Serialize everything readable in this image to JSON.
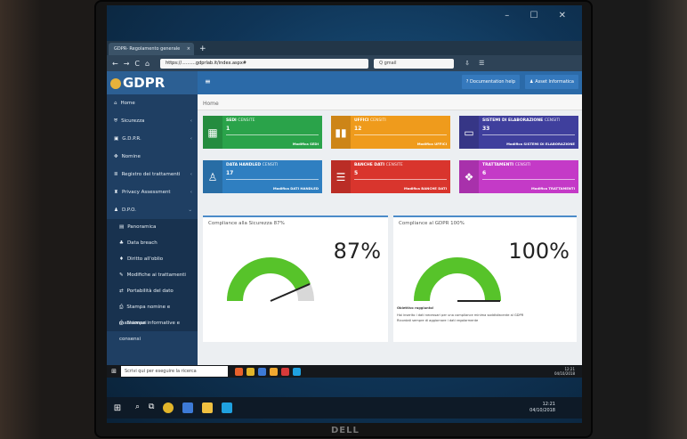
{
  "browser": {
    "tab_title": "GDPR- Regolamento generale",
    "tab_close": "×",
    "new_tab": "+",
    "url": "https://..........gdprlab.it/index.aspx#",
    "search_value": "Q gmail",
    "nav_back": "←",
    "nav_forward": "→",
    "nav_reload": "C",
    "nav_home": "⌂"
  },
  "app": {
    "brand": "GDPR",
    "topbar": {
      "menu_icon": "≡",
      "doc_help": "Documentation help",
      "user": "Asset Informatica"
    },
    "breadcrumb": "Home"
  },
  "sidebar": {
    "items": [
      {
        "icon": "⌂",
        "label": "Home"
      },
      {
        "icon": "⛨",
        "label": "Sicurezza",
        "chev": "‹"
      },
      {
        "icon": "▣",
        "label": "G.D.P.R.",
        "chev": "‹"
      },
      {
        "icon": "✥",
        "label": "Nomine"
      },
      {
        "icon": "≣",
        "label": "Registro dei trattamenti",
        "chev": "‹"
      },
      {
        "icon": "♜",
        "label": "Privacy Assessment",
        "chev": "‹"
      },
      {
        "icon": "♟",
        "label": "D.P.O.",
        "chev": "⌄"
      }
    ],
    "subitems": [
      {
        "icon": "▤",
        "label": "Panoramica"
      },
      {
        "icon": "♣",
        "label": "Data breach"
      },
      {
        "icon": "♦",
        "label": "Diritto all'oblio"
      },
      {
        "icon": "✎",
        "label": "Modifiche ai trattamenti"
      },
      {
        "icon": "⇄",
        "label": "Portabilità del dato"
      },
      {
        "icon": "⎙",
        "label": "Stampa nomine e mansionari"
      },
      {
        "icon": "⎙",
        "label": "Stampa informative e consensi"
      }
    ]
  },
  "boxes": [
    {
      "title": "SEDI",
      "sub": "CENSITE",
      "count": "1",
      "link": "Modifica SEDI",
      "color": "#2aa34a",
      "icon": "▦"
    },
    {
      "title": "UFFICI",
      "sub": "CENSITI",
      "count": "12",
      "link": "Modifica UFFICI",
      "color": "#ef9b1c",
      "icon": "▮▮"
    },
    {
      "title": "SISTEMI DI ELABORAZIONE",
      "sub": "CENSITI",
      "count": "33",
      "link": "Modifica SISTEMI DI ELABORAZIONE",
      "color": "#3f3f9d",
      "icon": "▭"
    },
    {
      "title": "DATA HANDLED",
      "sub": "CENSITI",
      "count": "17",
      "link": "Modifica DATI HANDLED",
      "color": "#2f7fc1",
      "icon": "♙"
    },
    {
      "title": "BANCHE DATI",
      "sub": "CENSITE",
      "count": "5",
      "link": "Modifica BANCHE DATI",
      "color": "#d9352d",
      "icon": "☰"
    },
    {
      "title": "TRATTAMENTI",
      "sub": "CENSITI",
      "count": "6",
      "link": "Modifica TRATTAMENTI",
      "color": "#c43ac7",
      "icon": "❖"
    }
  ],
  "compliance": [
    {
      "title": "Compliance alla Sicurezza 87%",
      "pct": "87%",
      "value": 0.87
    },
    {
      "title": "Compliance al GDPR 100%",
      "pct": "100%",
      "value": 1.0
    }
  ],
  "gdpr_note": {
    "heading": "Obiettivo raggiunto!",
    "text": "Hai inserito i dati necessari per una compliance minima soddisfacente al GDPR",
    "text2": "Ricordati sempre di aggiornare i dati regolarmente"
  },
  "remote_taskbar": {
    "start": "⊞",
    "search_placeholder": "Scrivi qui per eseguire la ricerca",
    "time": "12:21",
    "date": "04/10/2018"
  },
  "taskbar": {
    "start": "⊞",
    "time": "12:21",
    "date": "04/10/2018"
  },
  "window_controls": "–  ☐  ✕",
  "monitor_brand": "DELL"
}
